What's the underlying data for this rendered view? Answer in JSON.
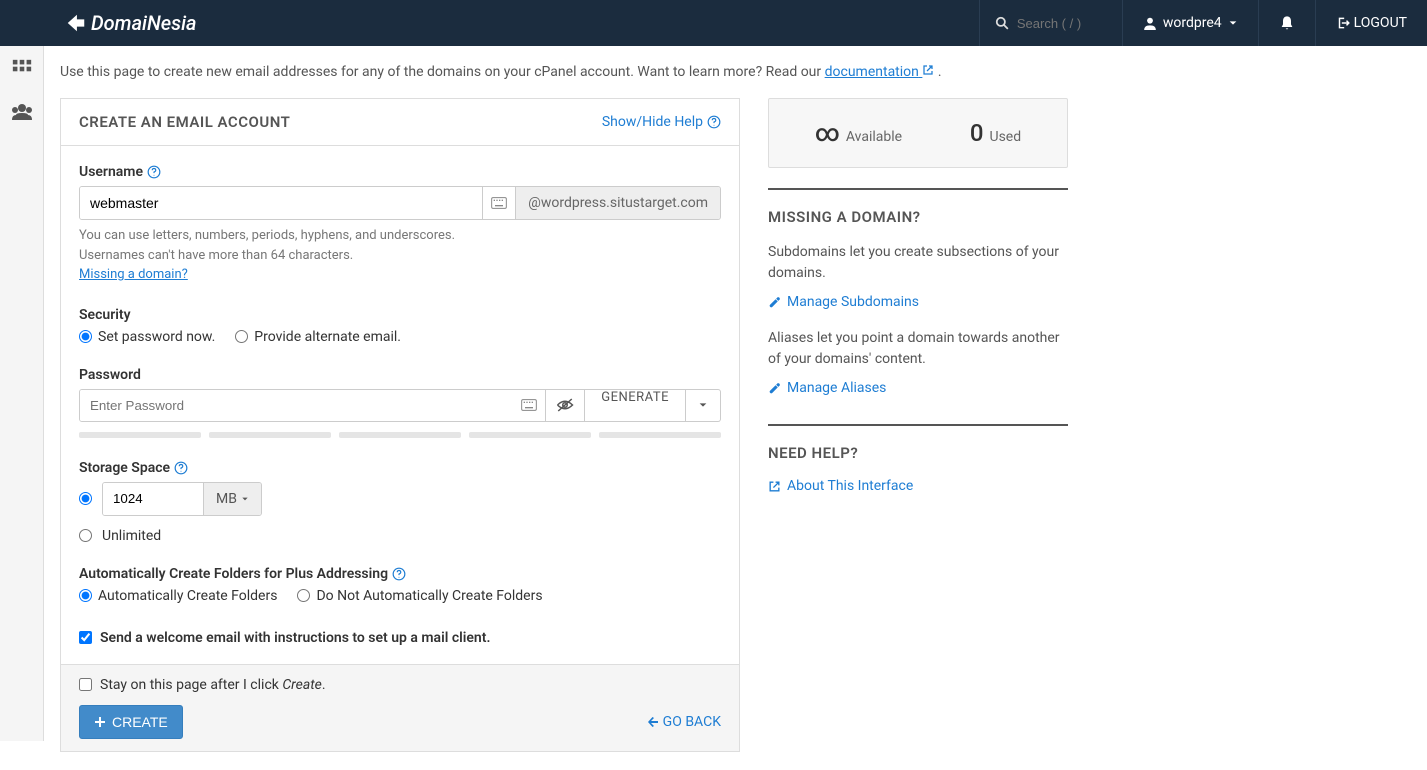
{
  "header": {
    "search_placeholder": "Search ( / )",
    "user": "wordpre4",
    "logout": "LOGOUT"
  },
  "intro": {
    "text_a": "Use this page to create new email addresses for any of the domains on your cPanel account. Want to learn more? Read our ",
    "doc_link": "documentation",
    "text_b": " ."
  },
  "panel": {
    "title": "CREATE AN EMAIL ACCOUNT",
    "help_toggle": "Show/Hide Help"
  },
  "username": {
    "label": "Username",
    "value": "webmaster",
    "domain": "@wordpress.situstarget.com",
    "hint1": "You can use letters, numbers, periods, hyphens, and underscores.",
    "hint2": "Usernames can't have more than 64 characters.",
    "missing_link": "Missing a domain?"
  },
  "security": {
    "label": "Security",
    "opt1": "Set password now.",
    "opt2": "Provide alternate email."
  },
  "password": {
    "label": "Password",
    "placeholder": "Enter Password",
    "generate": "GENERATE"
  },
  "storage": {
    "label": "Storage Space",
    "value": "1024",
    "unit": "MB",
    "unlimited": "Unlimited"
  },
  "plus": {
    "label": "Automatically Create Folders for Plus Addressing",
    "opt1": "Automatically Create Folders",
    "opt2": "Do Not Automatically Create Folders"
  },
  "welcome": {
    "label": "Send a welcome email with instructions to set up a mail client."
  },
  "stayopen": {
    "pre": "Stay on this page after I click ",
    "em": "Create",
    "post": "."
  },
  "actions": {
    "create": "CREATE",
    "goback": "GO BACK"
  },
  "stats": {
    "available_big": "∞",
    "available": "Available",
    "used_big": "0",
    "used": "Used"
  },
  "missing": {
    "title": "MISSING A DOMAIN?",
    "sub_text": "Subdomains let you create subsections of your domains.",
    "sub_link": "Manage Subdomains",
    "alias_text": "Aliases let you point a domain towards another of your domains' content.",
    "alias_link": "Manage Aliases"
  },
  "help": {
    "title": "NEED HELP?",
    "link": "About This Interface"
  }
}
